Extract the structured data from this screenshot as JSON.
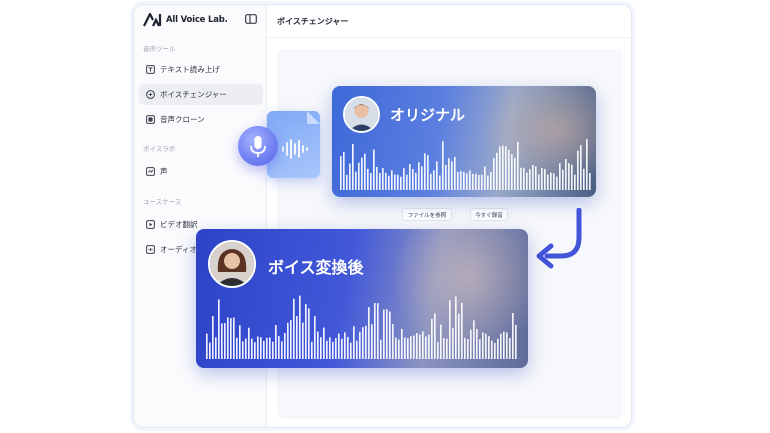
{
  "app": {
    "brand_name": "All Voice Lab.",
    "page_title": "ボイスチェンジャー"
  },
  "sidebar": {
    "sections": [
      {
        "label": "音声ツール"
      },
      {
        "label": "ボイスラボ"
      },
      {
        "label": "ユースケース"
      }
    ],
    "items": [
      {
        "label": "テキスト読み上げ",
        "icon": "text-to-speech-icon"
      },
      {
        "label": "ボイスチェンジャー",
        "icon": "voice-changer-icon",
        "active": true
      },
      {
        "label": "音声クローン",
        "icon": "voice-clone-icon"
      },
      {
        "label": "声",
        "icon": "voice-icon"
      },
      {
        "label": "ビデオ翻訳",
        "icon": "video-translate-icon"
      },
      {
        "label": "オーディオ",
        "icon": "audio-icon"
      }
    ]
  },
  "main": {
    "buttons": [
      {
        "label": "ファイルを参照"
      },
      {
        "label": "今すぐ録音"
      }
    ]
  },
  "overlay": {
    "original_label": "オリジナル",
    "converted_label": "ボイス変換後"
  },
  "colors": {
    "accent": "#4a5fe0",
    "sidebar_active_bg": "#eceef3"
  }
}
